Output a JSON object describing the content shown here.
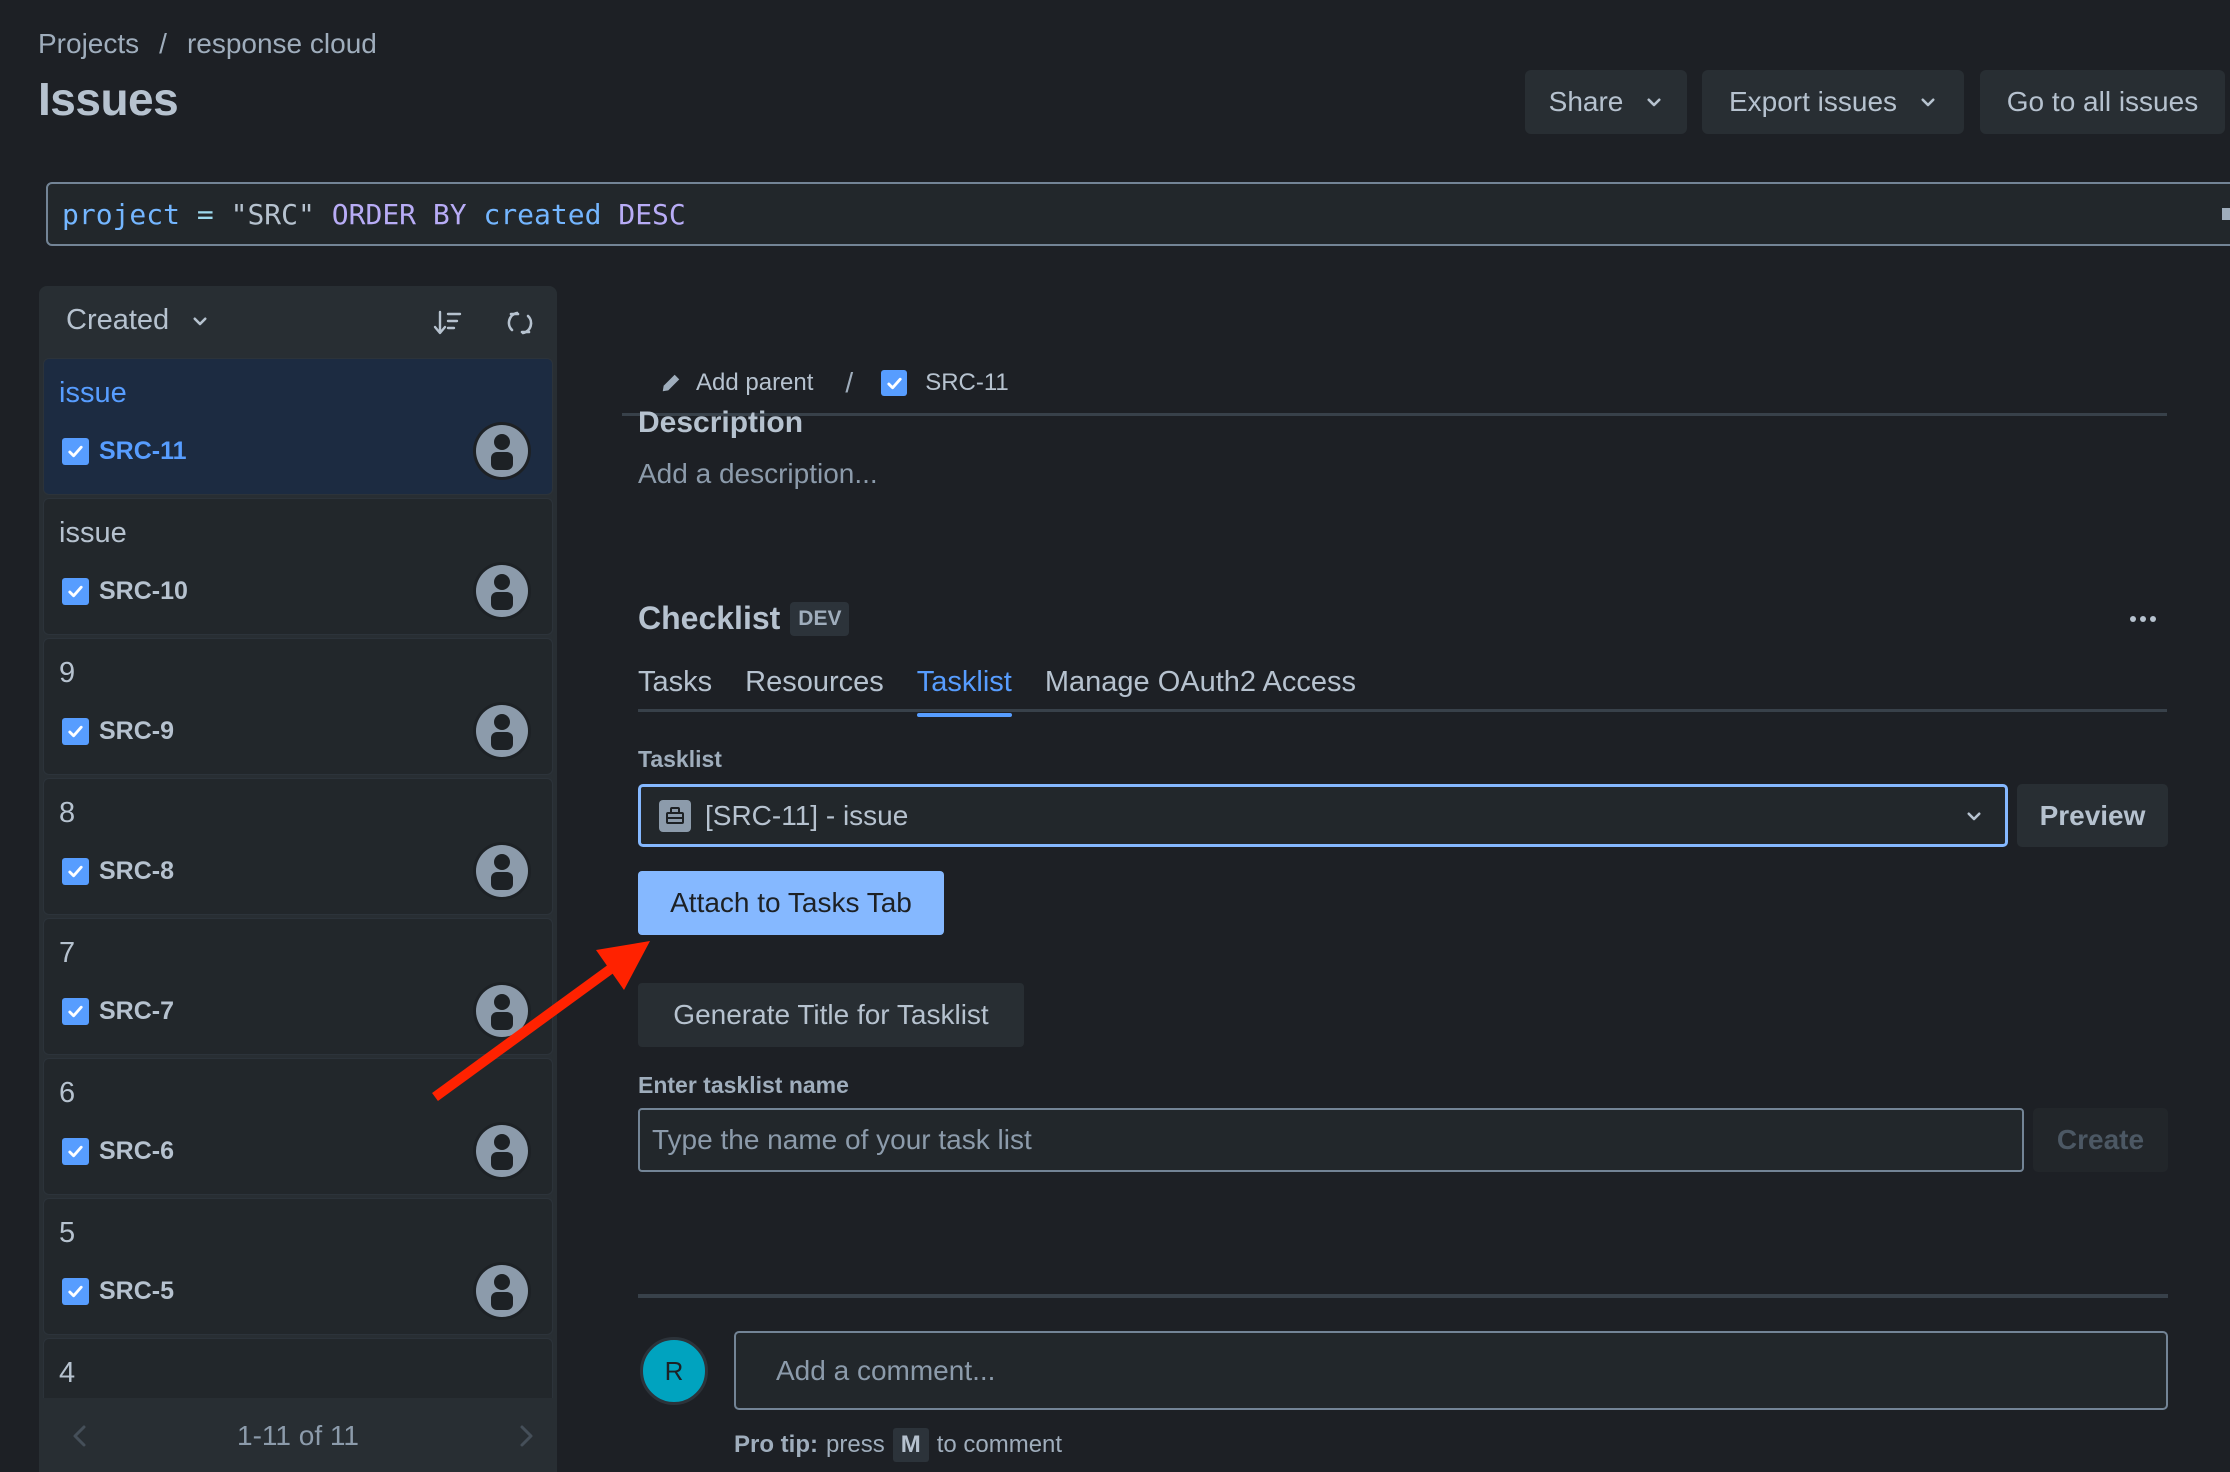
{
  "breadcrumb": {
    "items": [
      "Projects",
      "response cloud"
    ],
    "separator": "/"
  },
  "page_title": "Issues",
  "header_buttons": {
    "share": "Share",
    "export": "Export issues",
    "all_issues": "Go to all issues"
  },
  "jql": {
    "field": "project",
    "operator": "=",
    "value": "\"SRC\"",
    "order_kw": "ORDER BY",
    "order_field": "created",
    "direction": "DESC"
  },
  "sidebar": {
    "sort_label": "Created",
    "pagination": "1-11 of 11",
    "items": [
      {
        "title": "issue",
        "key": "SRC-11",
        "selected": true
      },
      {
        "title": "issue",
        "key": "SRC-10"
      },
      {
        "title": "9",
        "key": "SRC-9"
      },
      {
        "title": "8",
        "key": "SRC-8"
      },
      {
        "title": "7",
        "key": "SRC-7"
      },
      {
        "title": "6",
        "key": "SRC-6"
      },
      {
        "title": "5",
        "key": "SRC-5"
      },
      {
        "title": "4",
        "key": ""
      }
    ]
  },
  "issue": {
    "add_parent": "Add parent",
    "key": "SRC-11",
    "description_title": "Description",
    "description_placeholder": "Add a description..."
  },
  "checklist": {
    "title": "Checklist",
    "badge": "DEV",
    "tabs": [
      "Tasks",
      "Resources",
      "Tasklist",
      "Manage OAuth2 Access"
    ],
    "active_tab": "Tasklist",
    "tasklist_label": "Tasklist",
    "tasklist_selected": "[SRC-11] - issue",
    "preview_label": "Preview",
    "attach_label": "Attach to Tasks Tab",
    "generate_label": "Generate Title for Tasklist",
    "name_label": "Enter tasklist name",
    "name_placeholder": "Type the name of your task list",
    "name_value": "",
    "create_label": "Create"
  },
  "comment": {
    "avatar_initial": "R",
    "placeholder": "Add a comment...",
    "protip_bold": "Pro tip:",
    "protip_pre": "press",
    "protip_key": "M",
    "protip_post": "to comment"
  },
  "colors": {
    "background": "#1d2025",
    "accent": "#579dff",
    "primary_button": "#85b8ff",
    "annotation_arrow": "#ff2200",
    "avatar": "#00a3bf"
  }
}
